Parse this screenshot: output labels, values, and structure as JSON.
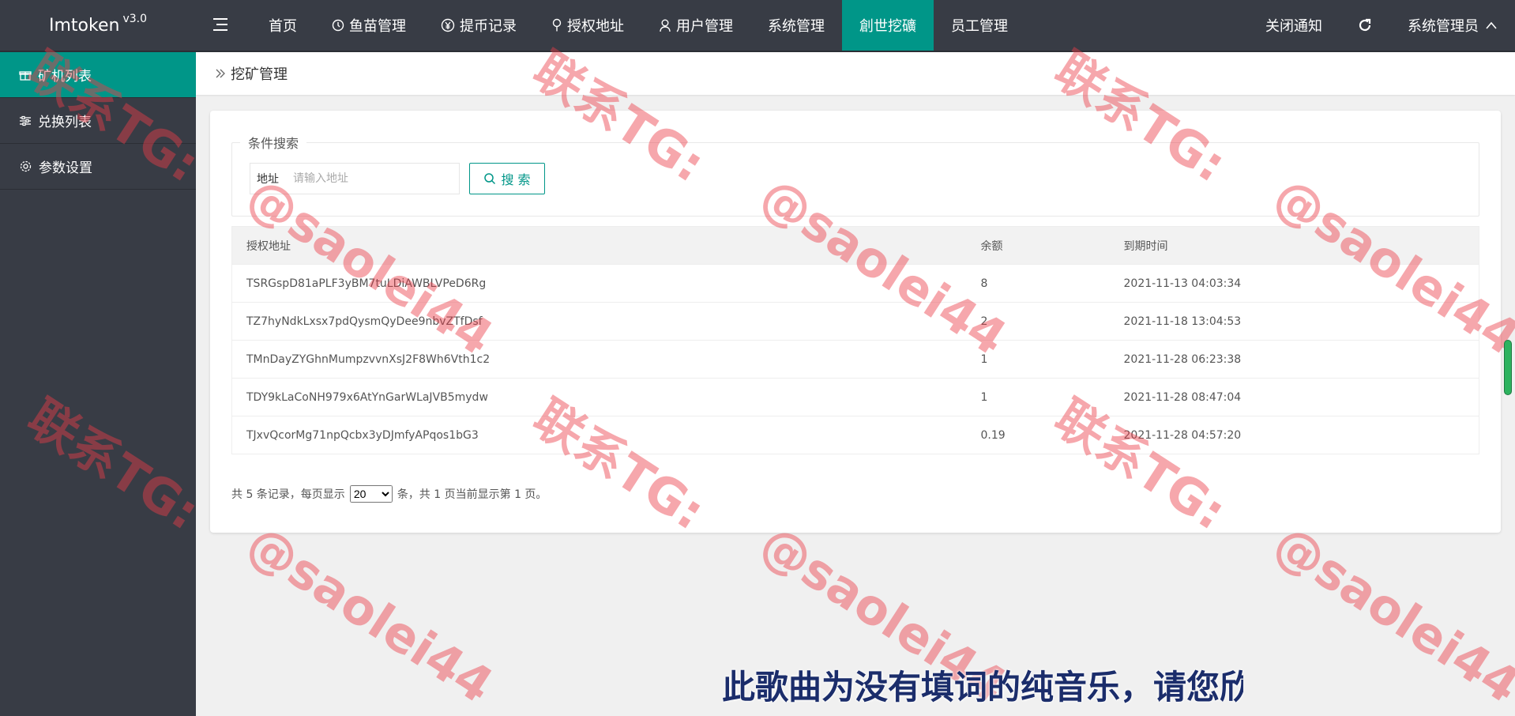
{
  "app": {
    "name": "Imtoken",
    "version": "v3.0"
  },
  "nav": [
    {
      "label": "首页",
      "icon": "home"
    },
    {
      "label": "鱼苗管理",
      "icon": "timer-icon"
    },
    {
      "label": "提币记录",
      "icon": "yen-icon"
    },
    {
      "label": "授权地址",
      "icon": "location-icon"
    },
    {
      "label": "用户管理",
      "icon": "user-icon"
    },
    {
      "label": "系统管理",
      "icon": ""
    },
    {
      "label": "創世挖礦",
      "icon": "",
      "active": true
    },
    {
      "label": "员工管理",
      "icon": ""
    }
  ],
  "nav_right": {
    "close_notice": "关闭通知",
    "admin": "系统管理员"
  },
  "sidebar": [
    {
      "label": "矿机列表",
      "icon": "gift-icon",
      "active": true
    },
    {
      "label": "兑换列表",
      "icon": "sliders-icon"
    },
    {
      "label": "参数设置",
      "icon": "gear-icon"
    }
  ],
  "breadcrumb": "挖矿管理",
  "search": {
    "legend": "条件搜索",
    "label": "地址",
    "placeholder": "请输入地址",
    "button": "搜 索"
  },
  "table": {
    "headers": [
      "授权地址",
      "余额",
      "到期时间"
    ],
    "rows": [
      [
        "TSRGspD81aPLF3yBM7tuLDiAWBLVPeD6Rg",
        "8",
        "2021-11-13 04:03:34"
      ],
      [
        "TZ7hyNdkLxsx7pdQysmQyDee9nbvZTfDsf",
        "2",
        "2021-11-18 13:04:53"
      ],
      [
        "TMnDayZYGhnMumpzvvnXsJ2F8Wh6Vth1c2",
        "1",
        "2021-11-28 06:23:38"
      ],
      [
        "TDY9kLaCoNH979x6AtYnGarWLaJVB5mydw",
        "1",
        "2021-11-28 08:47:04"
      ],
      [
        "TJxvQcorMg71npQcbx3yDJmfyAPqos1bG3",
        "0.19",
        "2021-11-28 04:57:20"
      ]
    ]
  },
  "pager": {
    "before": "共 5 条记录，每页显示",
    "page_size": "20",
    "after": "条，共 1 页当前显示第 1 页。"
  },
  "watermark": {
    "line1": "联系TG:",
    "line2": "@saolei44"
  },
  "subtitle": "此歌曲为没有填词的纯音乐，请您欣",
  "colors": {
    "topbar": "#383c45",
    "accent": "#009688",
    "watermark": "#eb3c46"
  }
}
